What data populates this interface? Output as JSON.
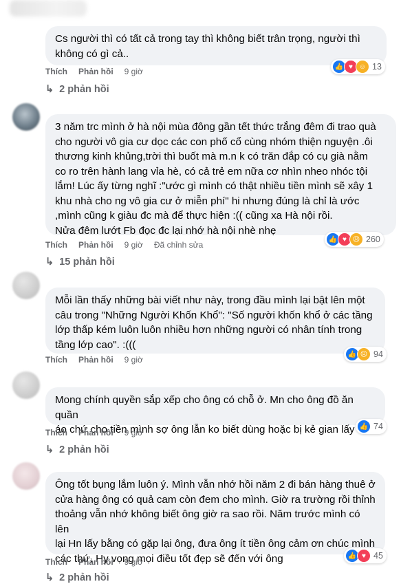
{
  "comments": [
    {
      "text": "Cs người thì có tất cả trong tay thì không biết trân trọng, người thì\nkhông có gì cả..",
      "like_label": "Thích",
      "reply_label": "Phản hồi",
      "time": "9 giờ",
      "edited": "",
      "reactions": [
        "like-icon",
        "love-icon",
        "care-icon"
      ],
      "reaction_count": "13",
      "replies": "2 phản hồi"
    },
    {
      "text": "3 năm trc mình ở hà nội mùa đông gần tết thức trắng đêm đi trao quà\ncho người vô gia cư dọc các con phố cổ cùng nhóm thiện nguyện .ôi\nthương kinh khủng,trời thì buốt mà m.n k có trăn đắp có cụ già nằm\nco ro trên hành lang vỉa hè, có cả trẻ em nữa cơ nhìn nheo nhóc tội\nlắm! Lúc ấy từng nghĩ :\"ước gì mình có thật nhiều tiền mình sẽ xây 1\nkhu nhà cho ng vô gia cư ở miễn phí\" hi nhưng đúng là chỉ là ước\n,mình cũng k giàu đc mà để thực hiện :(( cũng xa Hà nội rồi.\nNửa đêm lướt Fb đọc đc lại nhớ hà nội nhè nhẹ",
      "like_label": "Thích",
      "reply_label": "Phản hồi",
      "time": "9 giờ",
      "edited": "Đã chỉnh sửa",
      "reactions": [
        "like-icon",
        "love-icon",
        "sad-icon"
      ],
      "reaction_count": "260",
      "replies": "15 phản hồi"
    },
    {
      "text": "Mỗi lần thấy những bài viết như này, trong đầu mình lại bật lên một\ncâu trong \"Những Người Khốn Khổ\": \"Số người khốn khổ ở các tầng\nlớp thấp kém luôn luôn nhiều hơn những người có nhân tính trong\ntầng lớp cao\". :(((",
      "like_label": "Thích",
      "reply_label": "Phản hồi",
      "time": "9 giờ",
      "edited": "",
      "reactions": [
        "like-icon",
        "sad-icon"
      ],
      "reaction_count": "94",
      "replies": ""
    },
    {
      "text": "Mong chính quyền sắp xếp cho ông có chỗ ở. Mn cho ông đồ ăn quần\náo chứ cho tiền mình sợ ông lẫn ko biết dùng hoặc bị kẻ gian lấy",
      "like_label": "Thích",
      "reply_label": "Phản hồi",
      "time": "9 giờ",
      "edited": "",
      "reactions": [
        "like-icon"
      ],
      "reaction_count": "74",
      "replies": "2 phản hồi"
    },
    {
      "text": "Ông tốt bụng lắm luôn ý. Mình vẫn nhớ hồi năm 2 đi bán hàng thuê ở\ncửa hàng ông có quả cam còn đem cho mình. Giờ ra trường rồi thỉnh\nthoảng vẫn nhớ không biết ông giờ ra sao rồi. Năm trước mình có lên\nlại Hn lấy bằng có gặp lại ông, đưa ông ít tiền ông cảm ơn chúc mình\ncác thứ. Hy vọng mọi điều tốt đẹp sẽ đến với ông",
      "like_label": "Thích",
      "reply_label": "Phản hồi",
      "time": "9 giờ",
      "edited": "",
      "reactions": [
        "like-icon",
        "love-icon"
      ],
      "reaction_count": "45",
      "replies": "2 phản hồi"
    }
  ]
}
